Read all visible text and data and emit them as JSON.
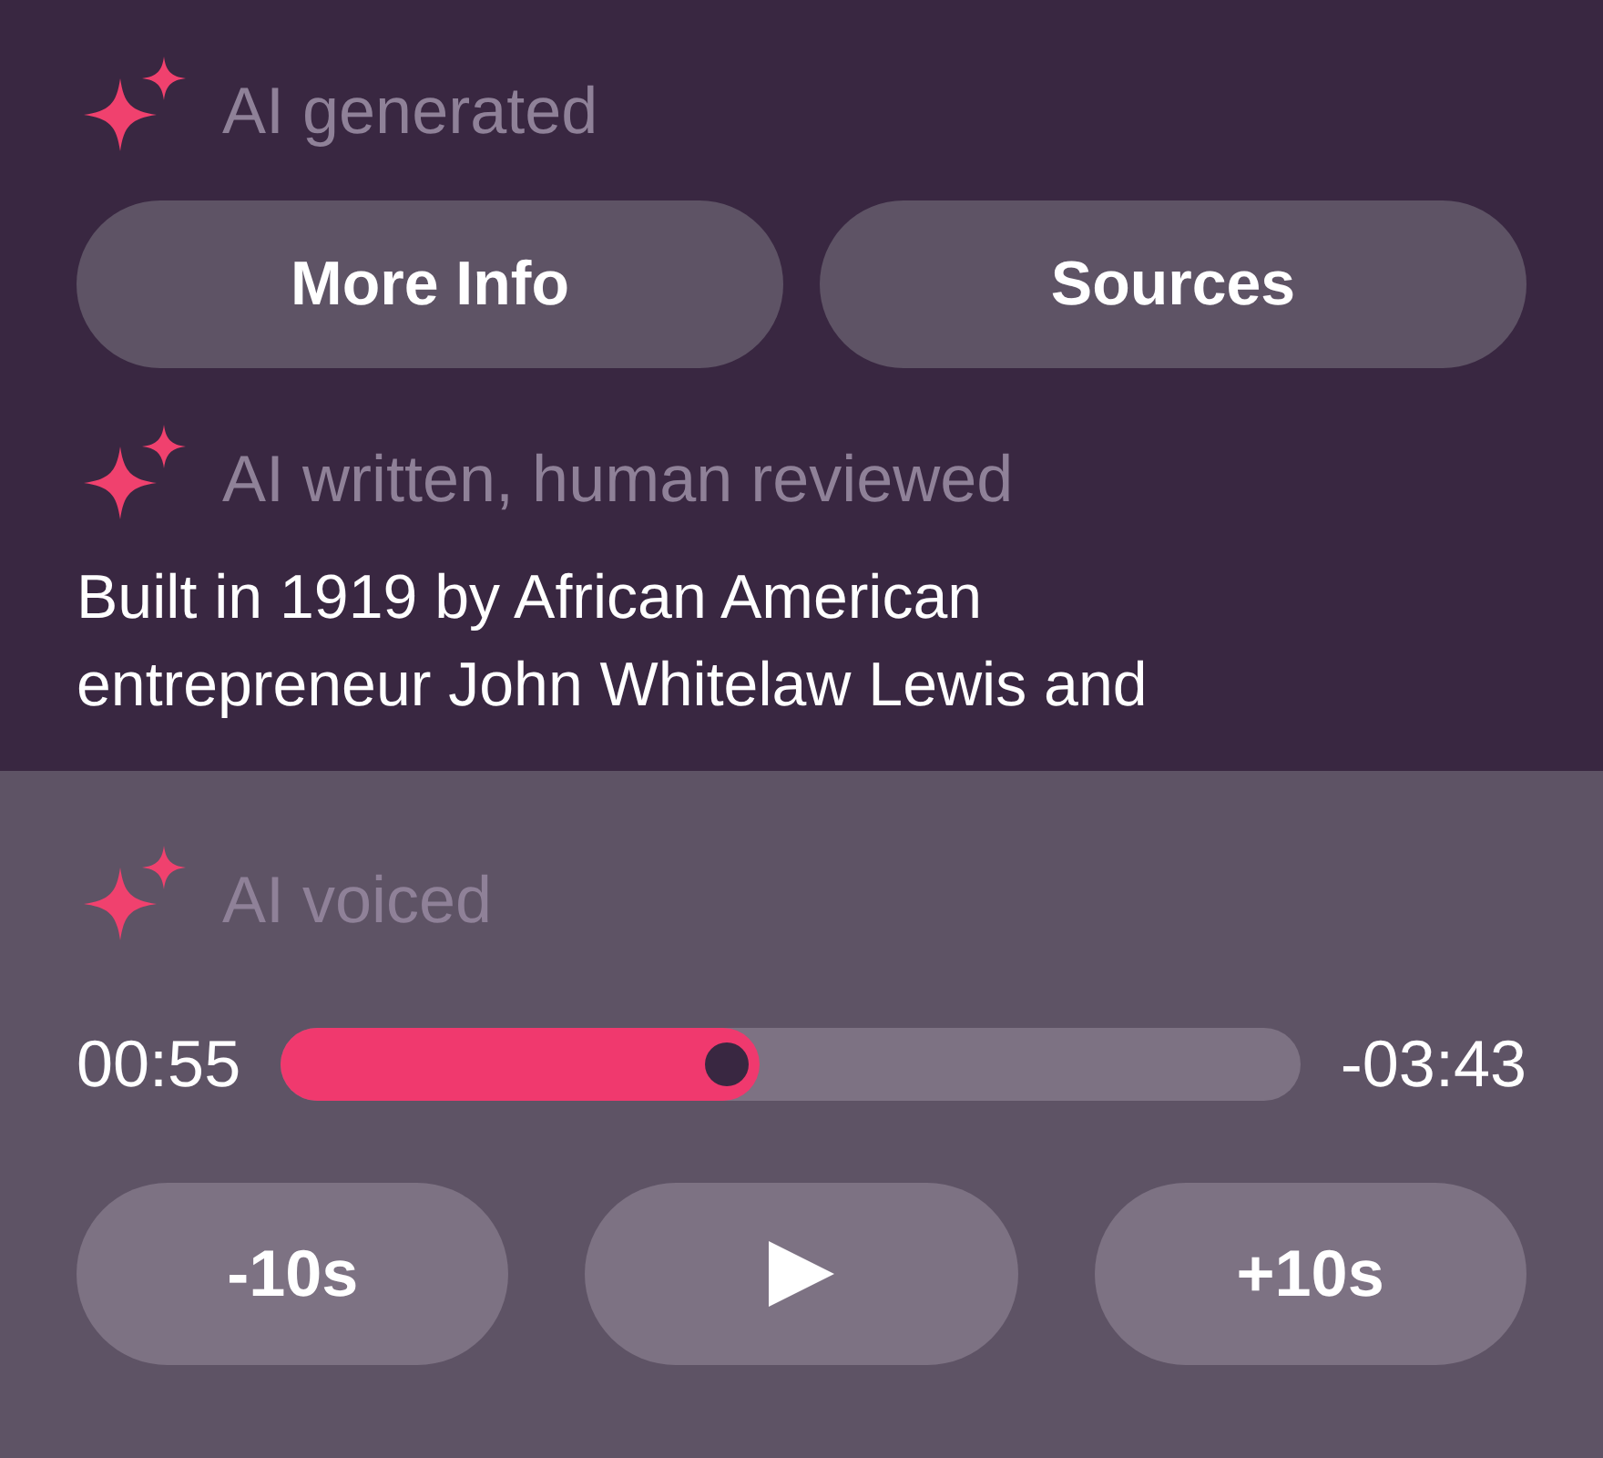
{
  "badges": [
    {
      "label": "AI generated"
    },
    {
      "label": "AI written, human reviewed"
    }
  ],
  "buttons": [
    {
      "label": "More Info"
    },
    {
      "label": "Sources"
    }
  ],
  "description": "Built in 1919 by African American entrepreneur John Whitelaw Lewis and",
  "player": {
    "badge": "AI voiced",
    "elapsed": "00:55",
    "remaining": "-03:43",
    "level": 0.47,
    "controls": [
      {
        "kind": "text",
        "label": "-10s"
      },
      {
        "kind": "play"
      },
      {
        "kind": "text",
        "label": "+10s"
      }
    ]
  }
}
